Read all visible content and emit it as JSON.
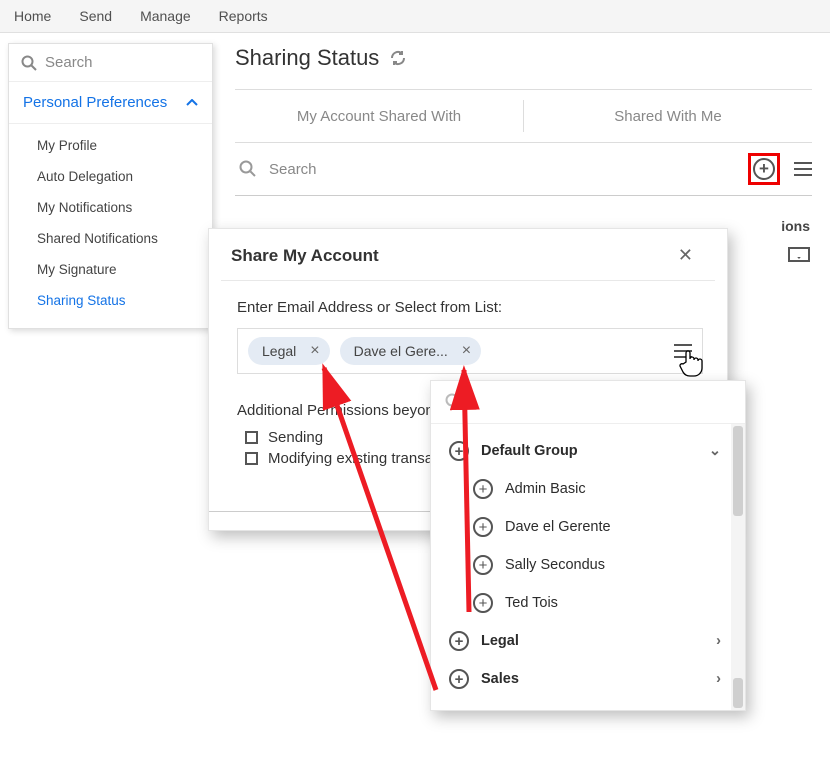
{
  "nav": {
    "home": "Home",
    "send": "Send",
    "manage": "Manage",
    "reports": "Reports"
  },
  "sidebar": {
    "search_placeholder": "Search",
    "section": "Personal Preferences",
    "items": [
      {
        "label": "My Profile"
      },
      {
        "label": "Auto Delegation"
      },
      {
        "label": "My Notifications"
      },
      {
        "label": "Shared Notifications"
      },
      {
        "label": "My Signature"
      },
      {
        "label": "Sharing Status",
        "active": true
      }
    ]
  },
  "page": {
    "title": "Sharing Status",
    "tab1": "My Account Shared With",
    "tab2": "Shared With Me",
    "search_placeholder": "Search",
    "bg_rights_header": "ions"
  },
  "modal": {
    "title": "Share My Account",
    "list_label": "Enter Email Address or Select from List:",
    "chip1": "Legal",
    "chip2": "Dave el Gere...",
    "perm_label": "Additional Permissions beyon",
    "perm1": "Sending",
    "perm2": "Modifying existing transacti"
  },
  "popover": {
    "group0": "Default Group",
    "u1": "Admin Basic",
    "u2": "Dave el Gerente",
    "u3": "Sally Secondus",
    "u4": "Ted Tois",
    "group1": "Legal",
    "group2": "Sales"
  }
}
